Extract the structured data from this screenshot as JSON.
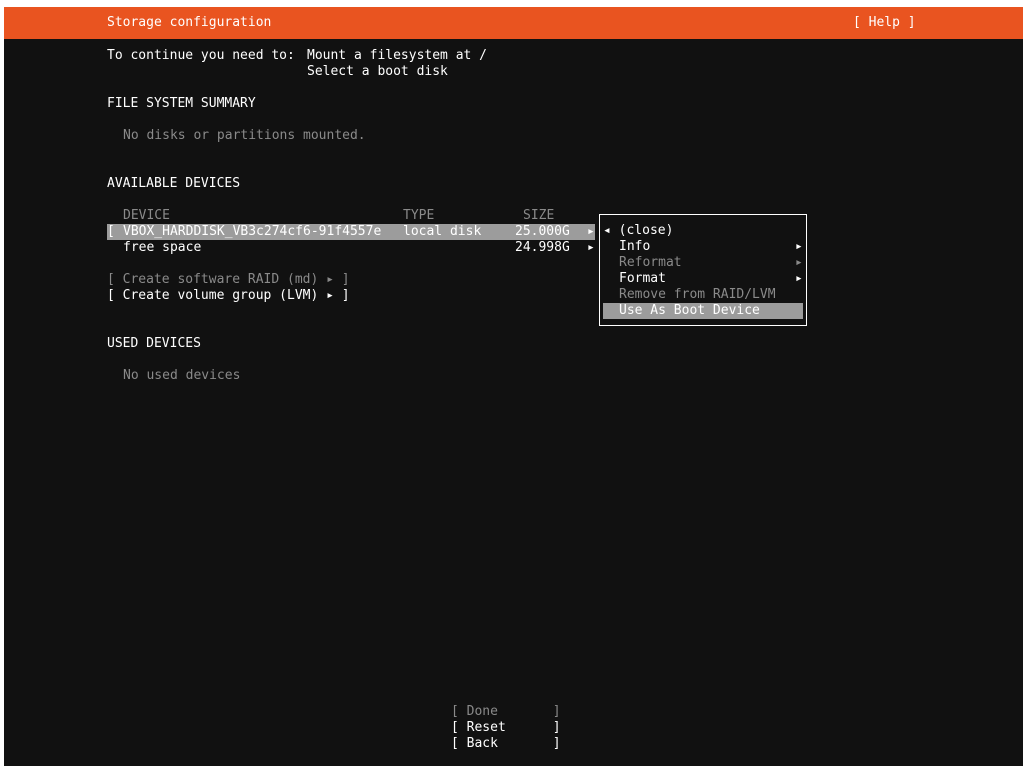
{
  "header": {
    "title": "Storage configuration",
    "help": "[ Help ]"
  },
  "requirements": {
    "prefix": "To continue you need to:",
    "items": [
      "Mount a filesystem at /",
      "Select a boot disk"
    ]
  },
  "fs_summary": {
    "heading": "FILE SYSTEM SUMMARY",
    "empty": "No disks or partitions mounted."
  },
  "available": {
    "heading": "AVAILABLE DEVICES",
    "columns": {
      "device": "DEVICE",
      "type": "TYPE",
      "size": "SIZE"
    },
    "disk": {
      "bracket": "[",
      "name": "VBOX_HARDDISK_VB3c274cf6-91f4557e",
      "type": "local disk",
      "size": "25.000G",
      "arrow": "▸"
    },
    "free": {
      "name": "free space",
      "size": "24.998G",
      "arrow": "▸"
    },
    "actions": [
      {
        "label": "[ Create software RAID (md) ▸ ]"
      },
      {
        "label": "[ Create volume group (LVM) ▸ ]"
      }
    ]
  },
  "used": {
    "heading": "USED DEVICES",
    "empty": "No used devices"
  },
  "menu": {
    "close": "◂ (close)",
    "items": [
      {
        "label": "Info",
        "arrow": "▸"
      },
      {
        "label": "Reformat",
        "arrow": "▸"
      },
      {
        "label": "Format",
        "arrow": "▸"
      },
      {
        "label": "Remove from RAID/LVM"
      },
      {
        "label": "Use As Boot Device"
      }
    ]
  },
  "buttons": {
    "done": "[ Done       ]",
    "reset": "[ Reset      ]",
    "back": "[ Back       ]"
  },
  "colors": {
    "accent": "#e95420",
    "background": "#111111",
    "highlight": "#9c9c9c",
    "disabled": "#8a8a8a"
  }
}
